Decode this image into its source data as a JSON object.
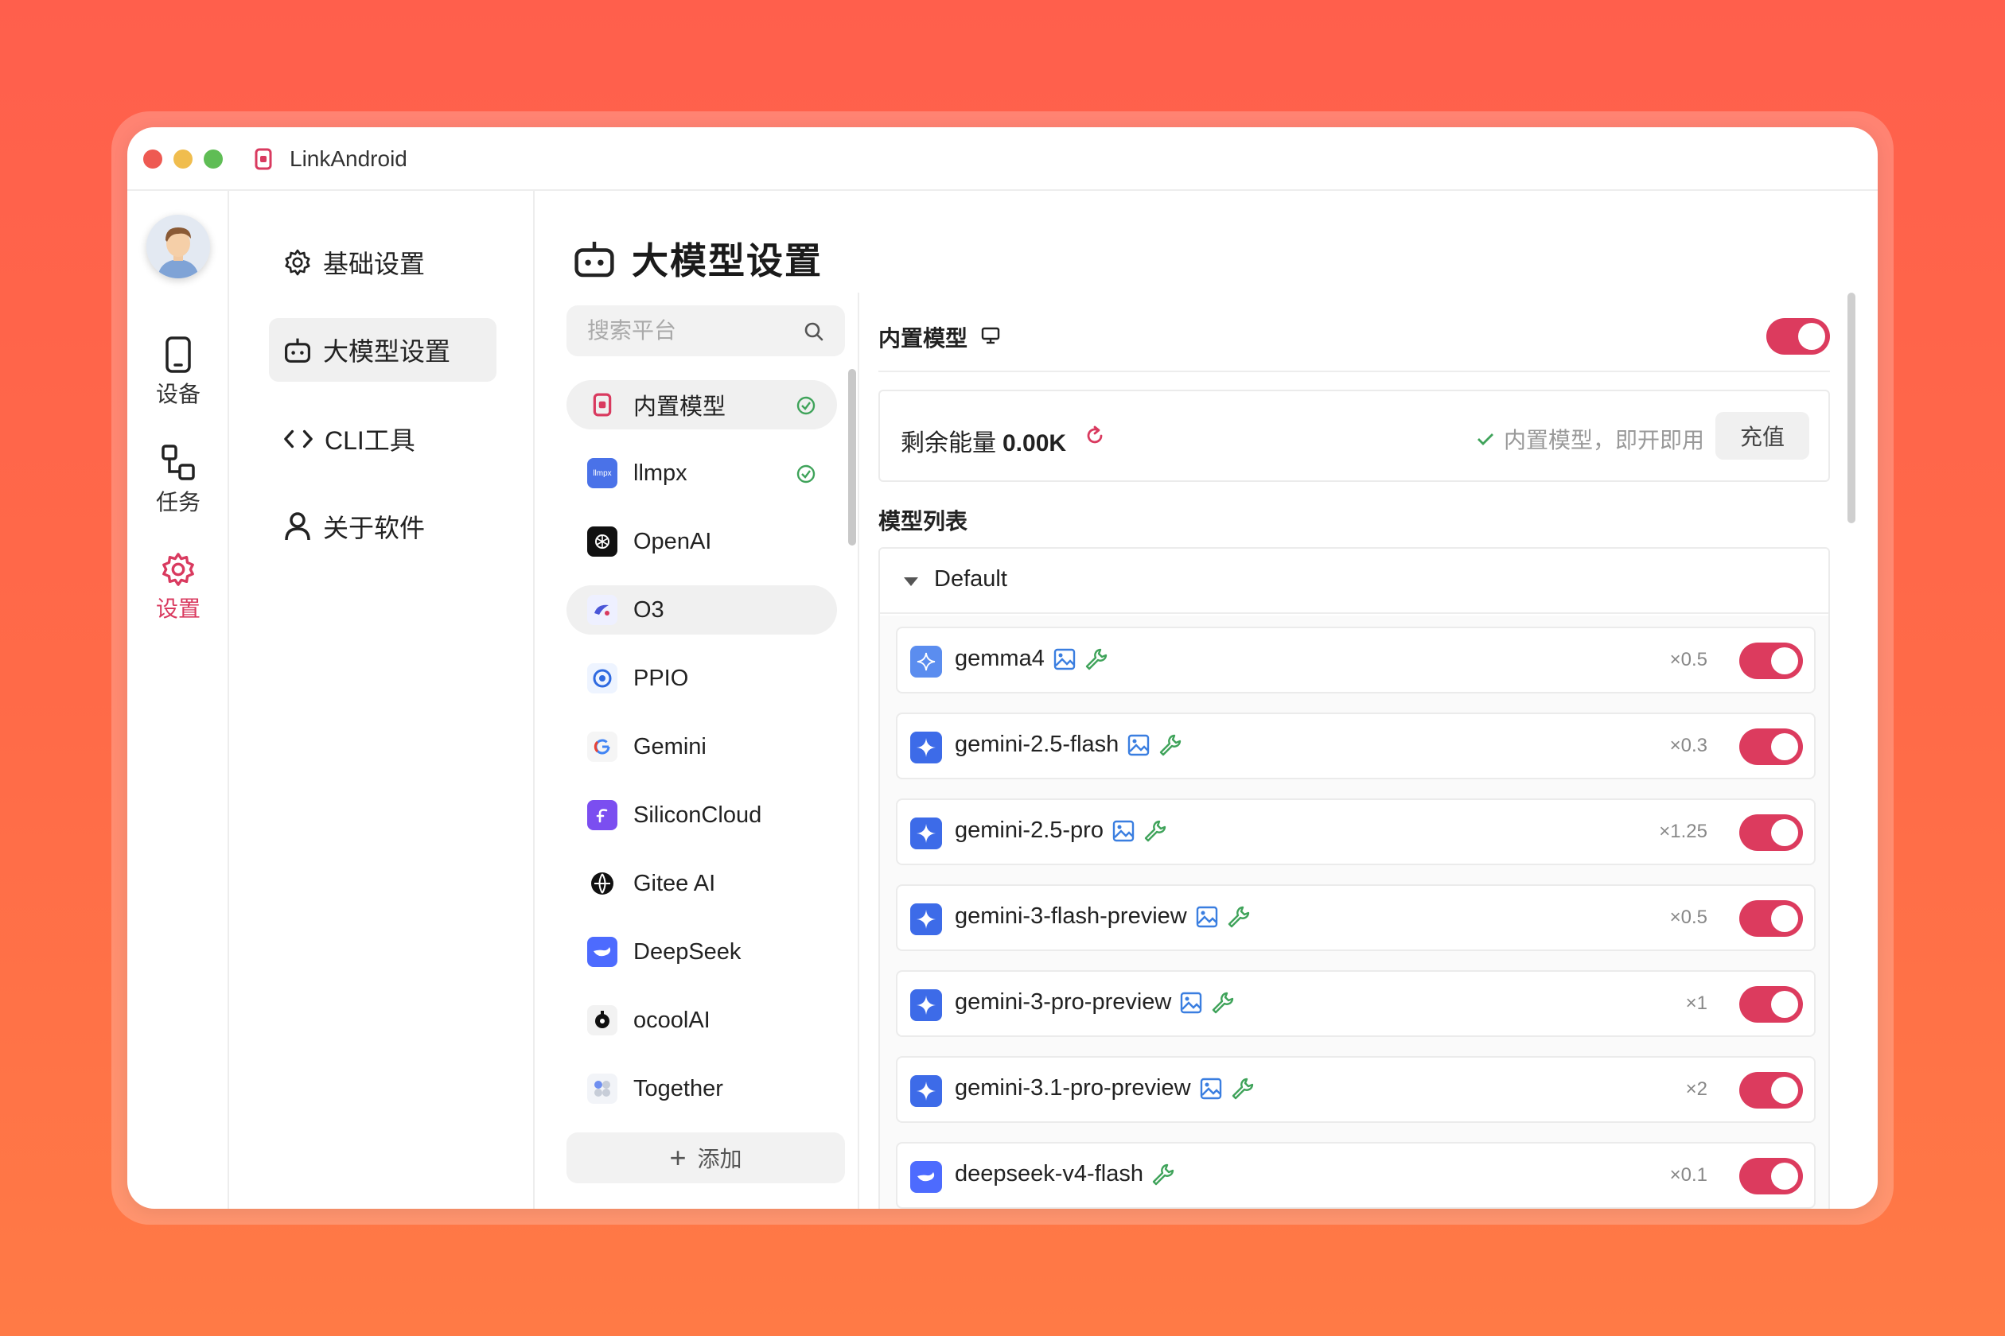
{
  "window": {
    "title": "LinkAndroid"
  },
  "iconbar": {
    "items": [
      {
        "label": "设备",
        "icon": "phone-icon"
      },
      {
        "label": "任务",
        "icon": "flow-icon"
      },
      {
        "label": "设置",
        "icon": "gear-icon"
      }
    ]
  },
  "menu": {
    "items": [
      {
        "label": "基础设置",
        "icon": "gear-icon"
      },
      {
        "label": "大模型设置",
        "icon": "robot-icon"
      },
      {
        "label": "CLI工具",
        "icon": "code-icon"
      },
      {
        "label": "关于软件",
        "icon": "user-icon"
      }
    ]
  },
  "main": {
    "title": "大模型设置"
  },
  "search": {
    "placeholder": "搜索平台"
  },
  "providers": [
    {
      "name": "内置模型",
      "checked": true
    },
    {
      "name": "llmpx",
      "checked": true,
      "logo_text": "llmpx"
    },
    {
      "name": "OpenAI"
    },
    {
      "name": "O3"
    },
    {
      "name": "PPIO"
    },
    {
      "name": "Gemini"
    },
    {
      "name": "SiliconCloud"
    },
    {
      "name": "Gitee AI"
    },
    {
      "name": "DeepSeek"
    },
    {
      "name": "ocoolAI"
    },
    {
      "name": "Together"
    }
  ],
  "add_button": {
    "label": "添加",
    "icon": "plus-icon"
  },
  "panel": {
    "header": "内置模型",
    "enabled": true,
    "energy_label": "剩余能量",
    "energy_value": "0.00K",
    "note": "内置模型，即开即用",
    "recharge_label": "充值",
    "models_label": "模型列表",
    "group_name": "Default"
  },
  "models": [
    {
      "name": "gemma4",
      "multiplier": "×0.5",
      "image": true,
      "tool": true,
      "enabled": true
    },
    {
      "name": "gemini-2.5-flash",
      "multiplier": "×0.3",
      "image": true,
      "tool": true,
      "enabled": true
    },
    {
      "name": "gemini-2.5-pro",
      "multiplier": "×1.25",
      "image": true,
      "tool": true,
      "enabled": true
    },
    {
      "name": "gemini-3-flash-preview",
      "multiplier": "×0.5",
      "image": true,
      "tool": true,
      "enabled": true
    },
    {
      "name": "gemini-3-pro-preview",
      "multiplier": "×1",
      "image": true,
      "tool": true,
      "enabled": true
    },
    {
      "name": "gemini-3.1-pro-preview",
      "multiplier": "×2",
      "image": true,
      "tool": true,
      "enabled": true
    },
    {
      "name": "deepseek-v4-flash",
      "multiplier": "×0.1",
      "image": false,
      "tool": true,
      "enabled": true
    }
  ],
  "colors": {
    "accent": "#dc3b5e",
    "check": "#3fa35a",
    "image_icon": "#3a7ee0",
    "tool_icon": "#3fa35a"
  }
}
